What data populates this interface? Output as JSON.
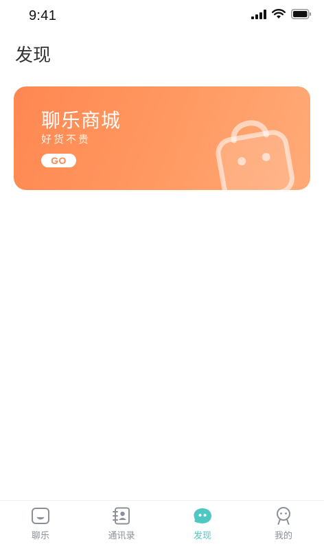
{
  "status_bar": {
    "time": "9:41"
  },
  "page": {
    "title": "发现"
  },
  "banner": {
    "title": "聊乐商城",
    "subtitle": "好货不贵",
    "button_label": "GO",
    "illustration_icon": "shopping-bag-icon"
  },
  "tabs": [
    {
      "label": "聊乐",
      "icon": "chat-icon",
      "active": false
    },
    {
      "label": "通讯录",
      "icon": "contacts-icon",
      "active": false
    },
    {
      "label": "发现",
      "icon": "discover-icon",
      "active": true
    },
    {
      "label": "我的",
      "icon": "profile-icon",
      "active": false
    }
  ],
  "colors": {
    "accent": "#4fc8c4",
    "banner_start": "#ff8751",
    "banner_end": "#ffab78",
    "tab_inactive": "#8a8f99"
  }
}
